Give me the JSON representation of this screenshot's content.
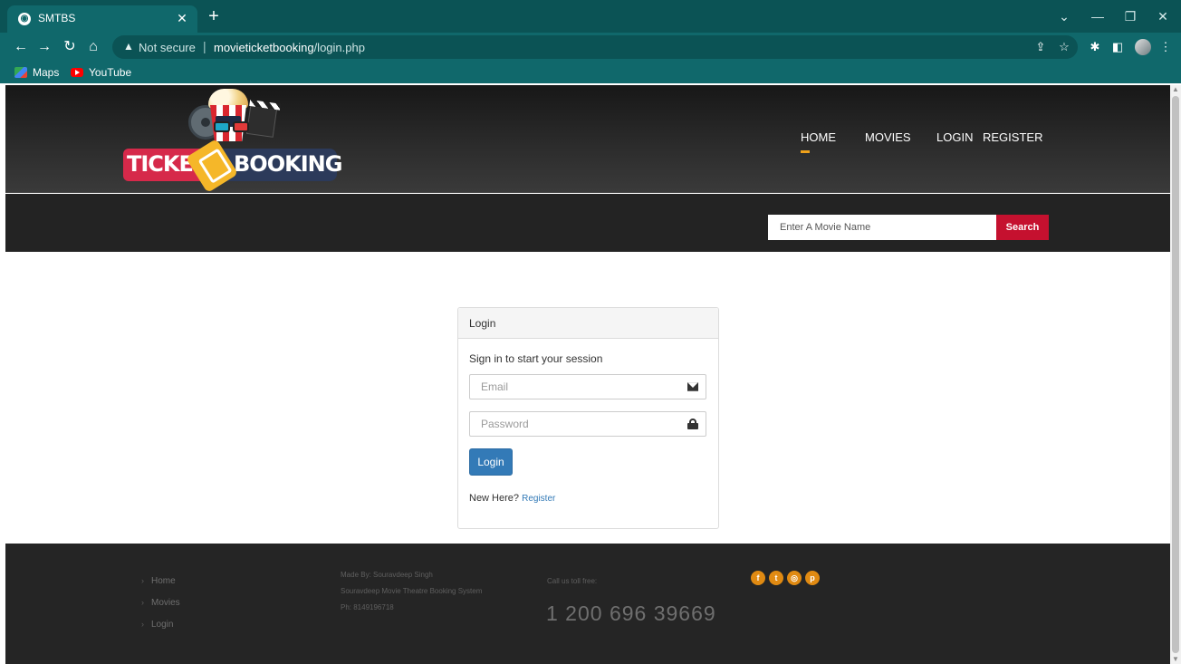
{
  "browser": {
    "tab_title": "SMTBS",
    "address_security": "Not secure",
    "url_host": "movieticketbooking",
    "url_path": "/login.php",
    "bookmarks": [
      "Maps",
      "YouTube"
    ]
  },
  "site": {
    "logo_text_left": "TICKE",
    "logo_text_right": "BOOKING",
    "nav": [
      "HOME",
      "MOVIES",
      "LOGIN",
      "REGISTER"
    ],
    "search_placeholder": "Enter A Movie Name",
    "search_button": "Search"
  },
  "login": {
    "title": "Login",
    "subtitle": "Sign in to start your session",
    "email_placeholder": "Email",
    "password_placeholder": "Password",
    "button": "Login",
    "new_here": "New Here?",
    "register_link": "Register"
  },
  "footer": {
    "links": [
      "Home",
      "Movies",
      "Login"
    ],
    "made_by": "Made By: Souravdeep Singh",
    "system_name": "Souravdeep Movie Theatre Booking System",
    "phone": "Ph: 8149196718",
    "toll_label": "Call us toll free:",
    "toll_number": "1 200 696 39669",
    "social_icons": [
      "facebook-icon",
      "twitter-icon",
      "dribbble-icon",
      "pinterest-icon"
    ]
  },
  "colors": {
    "chrome": "#10686b",
    "accent_nav": "#f0a21b",
    "search_button": "#c5112f",
    "login_button": "#337ab7",
    "social": "#e08a12"
  }
}
